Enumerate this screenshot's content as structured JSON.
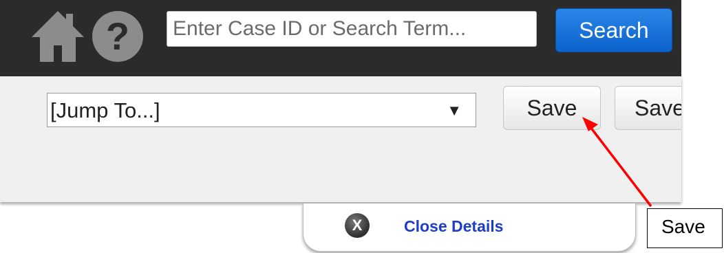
{
  "header": {
    "home_icon": "home-icon",
    "help_icon": "help-icon",
    "help_glyph": "?",
    "search": {
      "placeholder": "Enter Case ID or Search Term...",
      "value": ""
    },
    "search_button_label": "Search"
  },
  "toolbar": {
    "jump_to": {
      "selected": "[Jump To...]",
      "arrow": "▼"
    },
    "save_label": "Save",
    "save_partial_label": "Save"
  },
  "details_tab": {
    "close_icon": "close-circle-icon",
    "close_glyph": "X",
    "close_label": "Close Details"
  },
  "callout": {
    "label": "Save",
    "arrow_color": "#ff0000"
  },
  "colors": {
    "topbar": "#2b2b2b",
    "search_button": "#0b62cc",
    "toolbar_bg": "#f0f0f0",
    "link": "#1e3ccc"
  }
}
